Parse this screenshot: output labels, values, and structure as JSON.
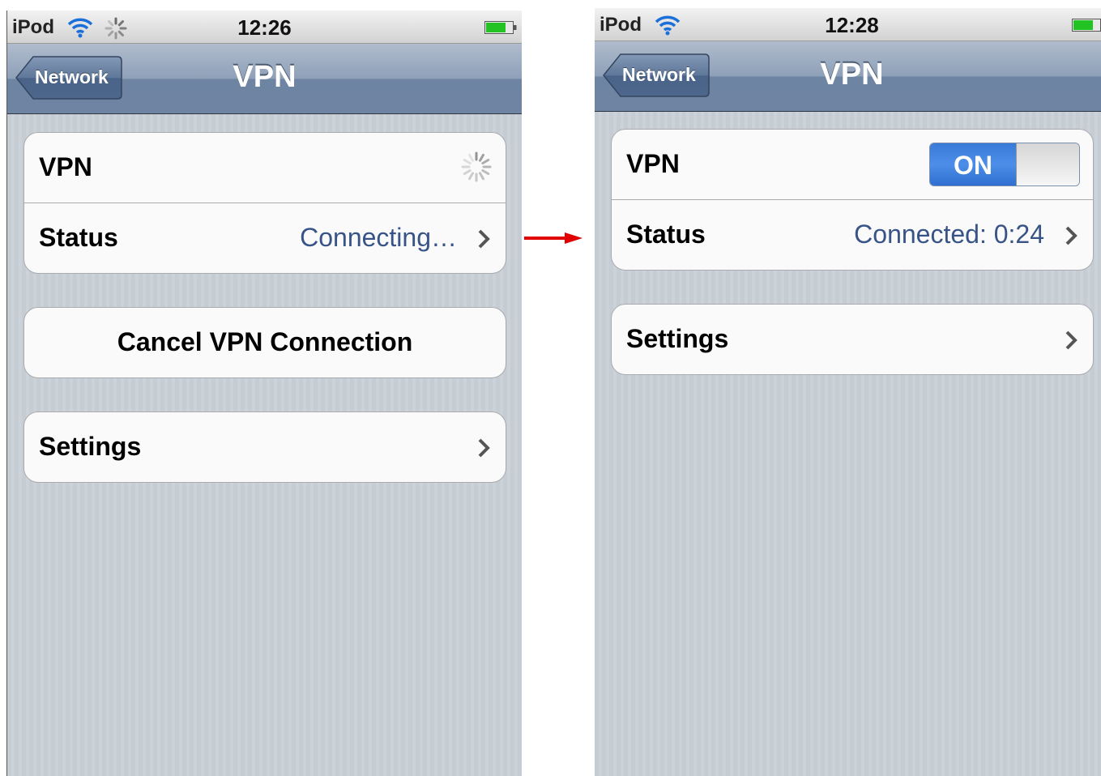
{
  "left": {
    "status_bar": {
      "carrier": "iPod",
      "time": "12:26"
    },
    "nav": {
      "back_label": "Network",
      "title": "VPN"
    },
    "vpn_row": {
      "label": "VPN"
    },
    "status_row": {
      "label": "Status",
      "value": "Connecting…"
    },
    "cancel_button": {
      "label": "Cancel VPN Connection"
    },
    "settings_row": {
      "label": "Settings"
    }
  },
  "right": {
    "status_bar": {
      "carrier": "iPod",
      "time": "12:28"
    },
    "nav": {
      "back_label": "Network",
      "title": "VPN"
    },
    "vpn_row": {
      "label": "VPN",
      "toggle": "ON"
    },
    "status_row": {
      "label": "Status",
      "value": "Connected: 0:24"
    },
    "settings_row": {
      "label": "Settings"
    }
  },
  "colors": {
    "accent_value": "#385487",
    "toggle_on": "#3a7ad8",
    "arrow": "#e00000",
    "battery_fill": "#22c322"
  },
  "icons": [
    "wifi-icon",
    "activity-spinner-icon",
    "battery-icon",
    "chevron-right-icon",
    "arrow-right-icon"
  ]
}
